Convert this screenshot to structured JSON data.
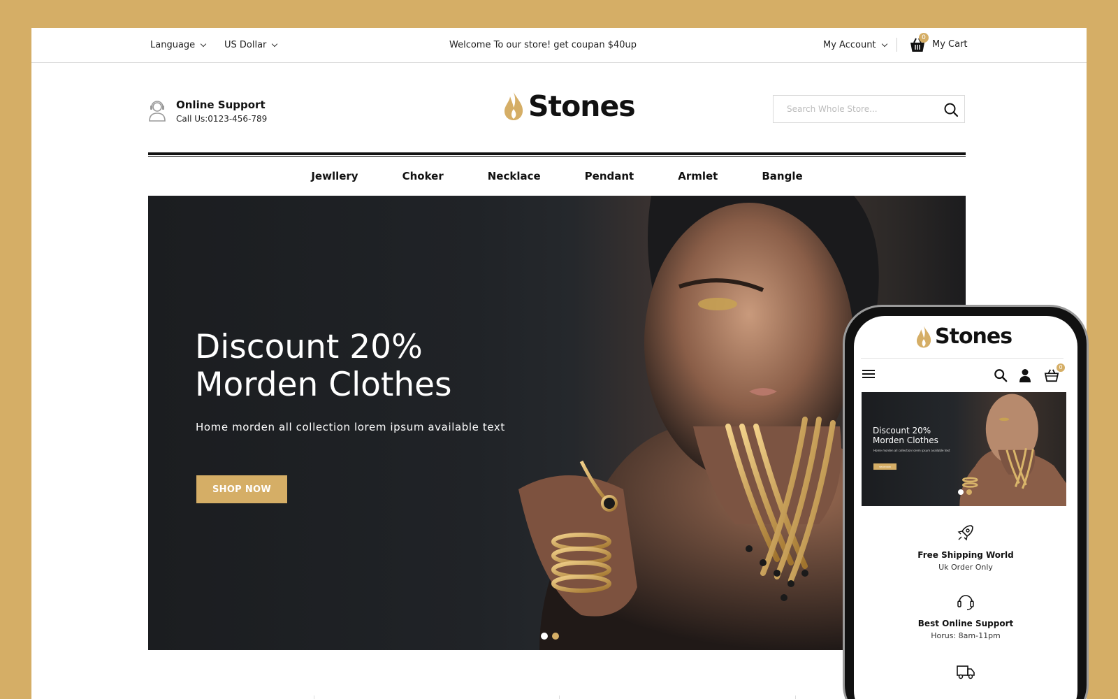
{
  "colors": {
    "accent": "#d5ae66",
    "dark": "#111111",
    "hero_bg": "#1e2024"
  },
  "topbar": {
    "language_label": "Language",
    "currency_label": "US Dollar",
    "welcome_text": "Welcome To our store! get coupan $40up",
    "account_label": "My Account",
    "cart_label": "My Cart",
    "cart_count": "0"
  },
  "header": {
    "support_title": "Online Support",
    "support_phone": "Call Us:0123-456-789",
    "logo_text": "Stones",
    "search_placeholder": "Search Whole Store..."
  },
  "nav": {
    "items": [
      {
        "label": "Jewllery"
      },
      {
        "label": "Choker"
      },
      {
        "label": "Necklace"
      },
      {
        "label": "Pendant"
      },
      {
        "label": "Armlet"
      },
      {
        "label": "Bangle"
      }
    ]
  },
  "hero": {
    "title_line1": "Discount 20%",
    "title_line2": "Morden Clothes",
    "subtitle": "Home morden all collection lorem ipsum available text",
    "button_label": "SHOP NOW",
    "slide_count": 2,
    "active_slide": 1
  },
  "phone": {
    "logo_text": "Stones",
    "cart_count": "0",
    "hero_title_line1": "Discount 20%",
    "hero_title_line2": "Morden Clothes",
    "hero_subtitle": "Home morden all collection lorem ipsum available text",
    "hero_button": "SHOP NOW",
    "features": [
      {
        "icon": "rocket-icon",
        "title": "Free Shipping World",
        "subtitle": "Uk Order Only"
      },
      {
        "icon": "headset-icon",
        "title": "Best Online Support",
        "subtitle": "Horus: 8am-11pm"
      },
      {
        "icon": "truck-icon",
        "title": "",
        "subtitle": ""
      }
    ]
  }
}
